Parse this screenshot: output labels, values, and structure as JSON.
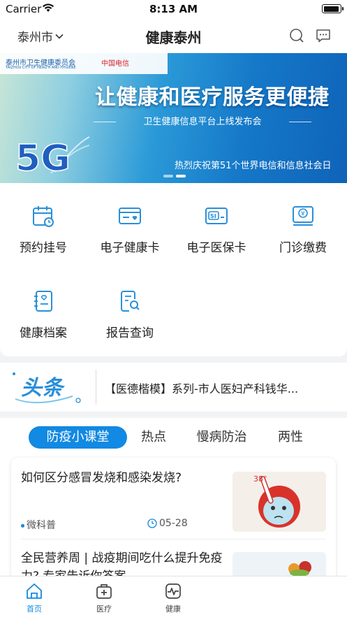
{
  "status_bar": {
    "carrier": "Carrier",
    "time": "8:13 AM"
  },
  "nav": {
    "city": "泰州市",
    "title": "健康泰州"
  },
  "banner": {
    "logo_text": "泰州市卫生健康委员会",
    "logo_sub": "TAIZHOU CITY OF HEALTH AND HYGIENE",
    "telecom": "中国电信",
    "headline": "让健康和医疗服务更便捷",
    "subtitle": "卫生健康信息平台上线发布会",
    "footer": "热烈庆祝第51个世界电信和信息社会日",
    "art_text": "5G"
  },
  "services": [
    {
      "label": "预约挂号",
      "icon": "calendar-icon"
    },
    {
      "label": "电子健康卡",
      "icon": "health-card-icon"
    },
    {
      "label": "电子医保卡",
      "icon": "insurance-card-icon"
    },
    {
      "label": "门诊缴费",
      "icon": "payment-icon"
    },
    {
      "label": "健康档案",
      "icon": "health-record-icon"
    },
    {
      "label": "报告查询",
      "icon": "report-search-icon"
    }
  ],
  "ticker": {
    "logo_text": "头条",
    "text": "【医德楷模】系列-市人医妇产科钱华..."
  },
  "tabs": [
    {
      "label": "防疫小课堂",
      "active": true
    },
    {
      "label": "热点",
      "active": false
    },
    {
      "label": "慢病防治",
      "active": false
    },
    {
      "label": "两性",
      "active": false
    }
  ],
  "articles": [
    {
      "title": "如何区分感冒发烧和感染发烧?",
      "source": "微科普",
      "date": "05-28",
      "thumb_text": "38°"
    },
    {
      "title": "全民营养周 | 战疫期间吃什么提升免疫力? 专家告诉你答案",
      "source": "",
      "date": ""
    }
  ],
  "tabbar": [
    {
      "label": "首页",
      "active": true,
      "icon": "home-icon"
    },
    {
      "label": "医疗",
      "active": false,
      "icon": "medical-kit-icon"
    },
    {
      "label": "健康",
      "active": false,
      "icon": "pulse-icon"
    }
  ],
  "colors": {
    "accent": "#1289e2",
    "icon_blue": "#2a8fd8"
  }
}
